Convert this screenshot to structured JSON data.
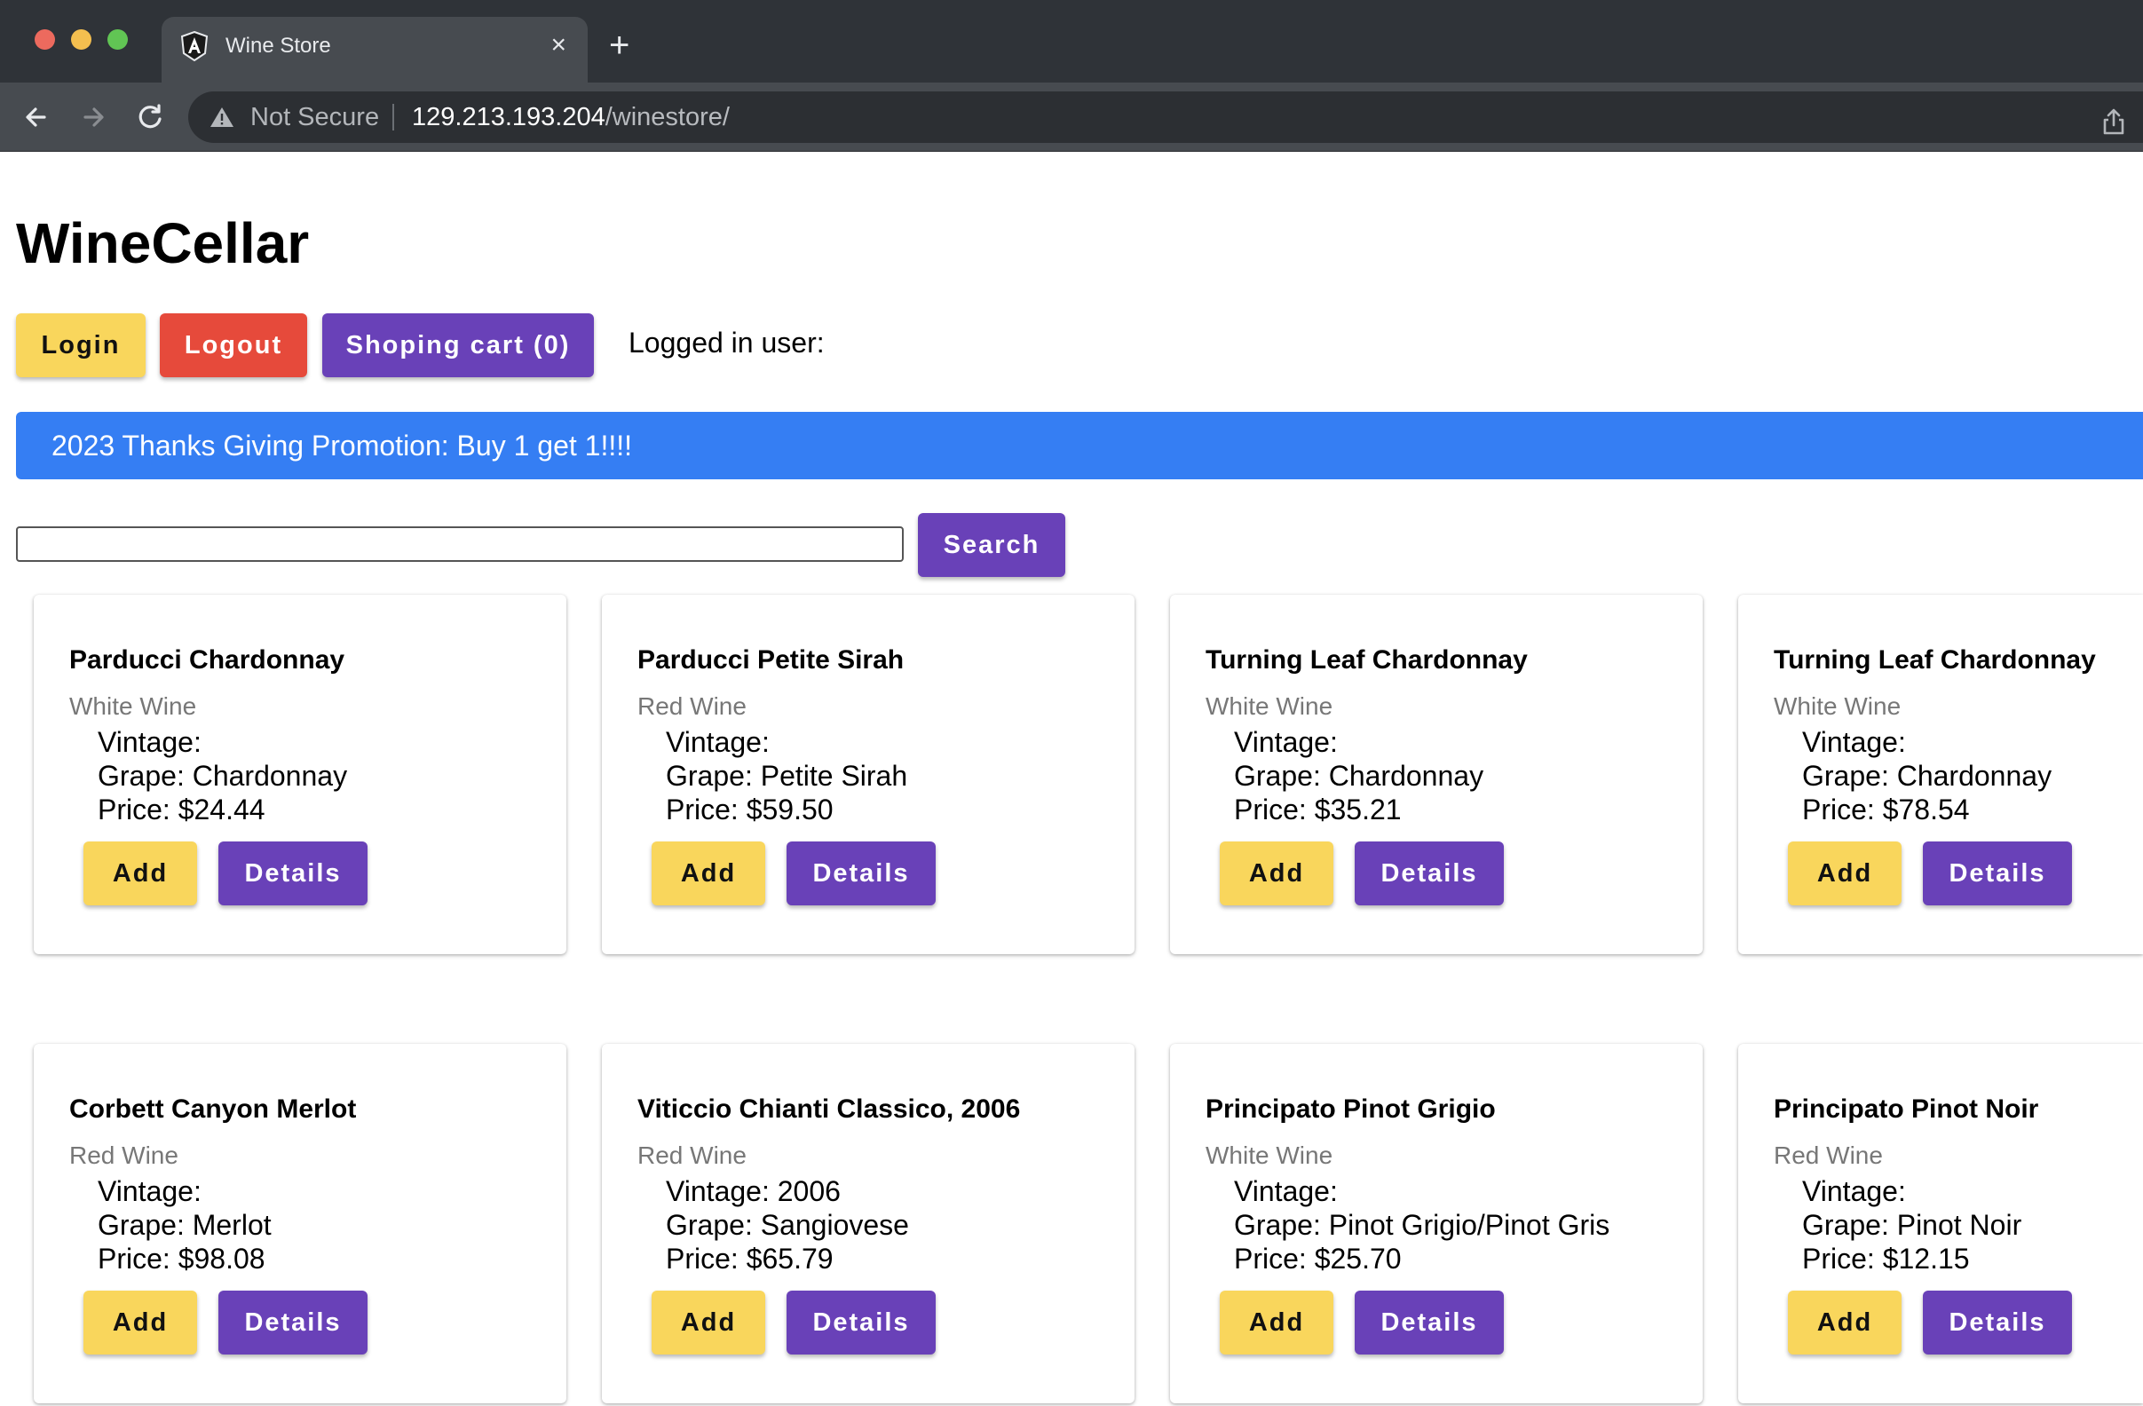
{
  "browser": {
    "tab_title": "Wine Store",
    "close_glyph": "×",
    "new_tab_glyph": "+",
    "security_label": "Not Secure",
    "url_host": "129.213.193.204",
    "url_path": "/winestore/",
    "colors": {
      "traffic_red": "#ec6a5e",
      "traffic_yellow": "#f4bf4f",
      "traffic_green": "#61c554"
    }
  },
  "app": {
    "title": "WineCellar",
    "login_label": "Login",
    "logout_label": "Logout",
    "cart_label": "Shoping cart (0)",
    "logged_in_label": "Logged in user:",
    "promo_text": "2023 Thanks Giving Promotion: Buy 1 get 1!!!!",
    "search_value": "",
    "search_label": "Search",
    "colors": {
      "yellow": "#f9d65c",
      "red": "#e64a3b",
      "purple": "#6941b8",
      "promo_blue": "#357ef3"
    }
  },
  "wines": [
    {
      "name": "Parducci Chardonnay",
      "type": "White Wine",
      "vintage": "Vintage:",
      "grape": "Grape: Chardonnay",
      "price": "Price: $24.44",
      "add_label": "Add",
      "details_label": "Details"
    },
    {
      "name": "Parducci Petite Sirah",
      "type": "Red Wine",
      "vintage": "Vintage:",
      "grape": "Grape: Petite Sirah",
      "price": "Price: $59.50",
      "add_label": "Add",
      "details_label": "Details"
    },
    {
      "name": "Turning Leaf Chardonnay",
      "type": "White Wine",
      "vintage": "Vintage:",
      "grape": "Grape: Chardonnay",
      "price": "Price: $35.21",
      "add_label": "Add",
      "details_label": "Details"
    },
    {
      "name": "Turning Leaf Chardonnay",
      "type": "White Wine",
      "vintage": "Vintage:",
      "grape": "Grape: Chardonnay",
      "price": "Price: $78.54",
      "add_label": "Add",
      "details_label": "Details"
    },
    {
      "name": "Corbett Canyon Merlot",
      "type": "Red Wine",
      "vintage": "Vintage:",
      "grape": "Grape: Merlot",
      "price": "Price: $98.08",
      "add_label": "Add",
      "details_label": "Details"
    },
    {
      "name": "Viticcio Chianti Classico, 2006",
      "type": "Red Wine",
      "vintage": "Vintage: 2006",
      "grape": "Grape: Sangiovese",
      "price": "Price: $65.79",
      "add_label": "Add",
      "details_label": "Details"
    },
    {
      "name": "Principato Pinot Grigio",
      "type": "White Wine",
      "vintage": "Vintage:",
      "grape": "Grape: Pinot Grigio/Pinot Gris",
      "price": "Price: $25.70",
      "add_label": "Add",
      "details_label": "Details"
    },
    {
      "name": "Principato Pinot Noir",
      "type": "Red Wine",
      "vintage": "Vintage:",
      "grape": "Grape: Pinot Noir",
      "price": "Price: $12.15",
      "add_label": "Add",
      "details_label": "Details"
    }
  ]
}
